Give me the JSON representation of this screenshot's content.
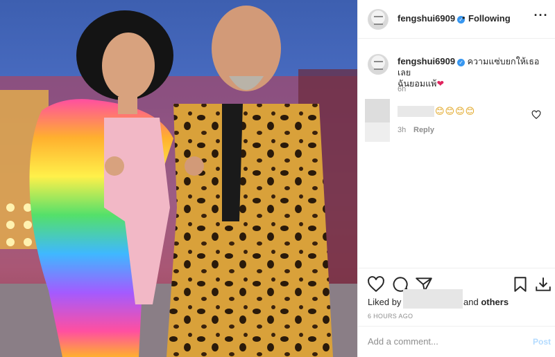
{
  "photo": {
    "description_icon": "post-photo"
  },
  "header": {
    "username": "fengshui6909",
    "verified_icon": "verified-badge-icon",
    "separator": "•",
    "follow_status": "Following",
    "more_icon": "more-options-icon"
  },
  "caption": {
    "username": "fengshui6909",
    "text_line1": "ความแซ่บยกให้เธอเลย",
    "text_line2": "ฉันยอมแพ้",
    "emoji": "❤",
    "time": "6h"
  },
  "comment": {
    "emoji_text": "😊😊😊😊",
    "time": "3h",
    "reply_label": "Reply"
  },
  "actions": {
    "liked_by_label": "Liked by",
    "and_label": "and",
    "others_label": "others",
    "post_time": "6 HOURS AGO",
    "comment_placeholder": "Add a comment...",
    "post_label": "Post"
  },
  "colors": {
    "accent": "#3897f0",
    "post_disabled": "#b3dbff",
    "secondary_text": "#8e8e8e"
  }
}
